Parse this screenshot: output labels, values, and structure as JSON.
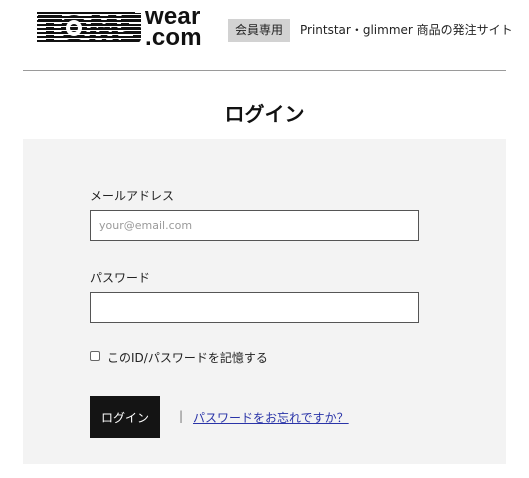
{
  "header": {
    "logo": {
      "word_main": "TOMS",
      "word_wear": "wear",
      "word_com": ".com"
    },
    "member_badge": "会員専用",
    "site_description": "Printstar・glimmer 商品の発注サイト"
  },
  "page_title": "ログイン",
  "form": {
    "email": {
      "label": "メールアドレス",
      "placeholder": "your@email.com",
      "value": ""
    },
    "password": {
      "label": "パスワード",
      "placeholder": "",
      "value": ""
    },
    "remember": {
      "label": "このID/パスワードを記憶する",
      "checked": false
    },
    "login_button": "ログイン",
    "separator": "|",
    "forgot_link": "パスワードをお忘れですか？"
  },
  "colors": {
    "panel_bg": "#f3f3f3",
    "button_bg": "#141414",
    "link": "#2a34a8",
    "badge_bg": "#d2d2d2"
  }
}
